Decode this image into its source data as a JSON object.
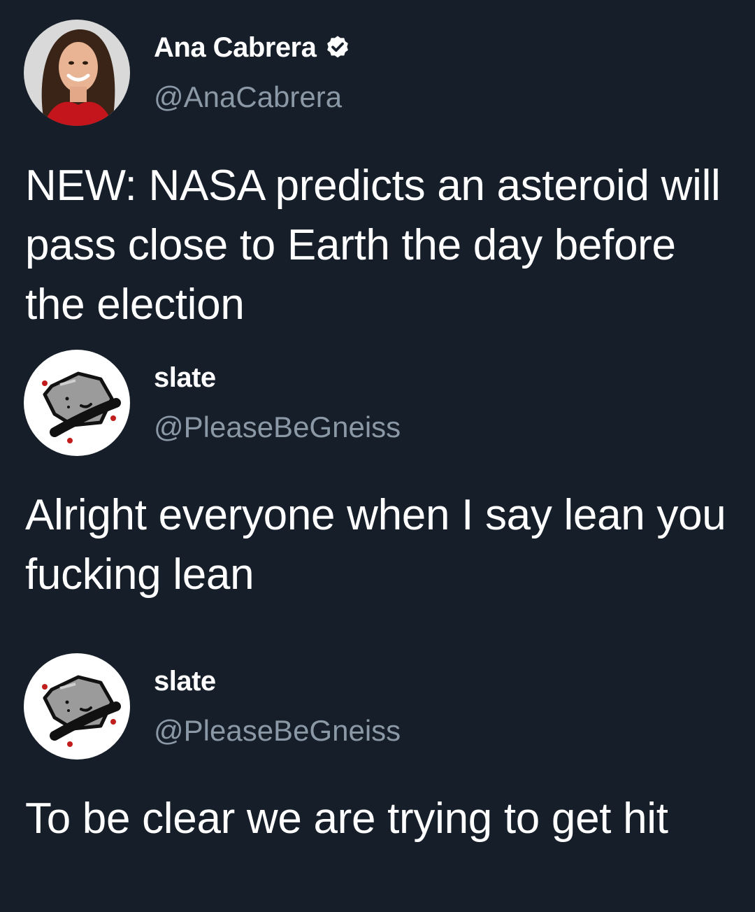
{
  "tweets": [
    {
      "display_name": "Ana Cabrera",
      "handle": "@AnaCabrera",
      "verified": true,
      "text": "NEW: NASA predicts an asteroid will pass close to Earth the day before the election"
    },
    {
      "display_name": "slate",
      "handle": "@PleaseBeGneiss",
      "verified": false,
      "text": "Alright everyone when I say lean you fucking lean"
    },
    {
      "display_name": "slate",
      "handle": "@PleaseBeGneiss",
      "verified": false,
      "text": "To be clear we are trying to get hit"
    }
  ],
  "colors": {
    "background": "#161e29",
    "text": "#ffffff",
    "handle": "#8b98a5",
    "verified_badge": "#ffffff"
  },
  "icons": {
    "verified": "verified-badge-icon",
    "avatar_1": "profile-photo-avatar",
    "avatar_2": "rock-on-skateboard-avatar"
  }
}
